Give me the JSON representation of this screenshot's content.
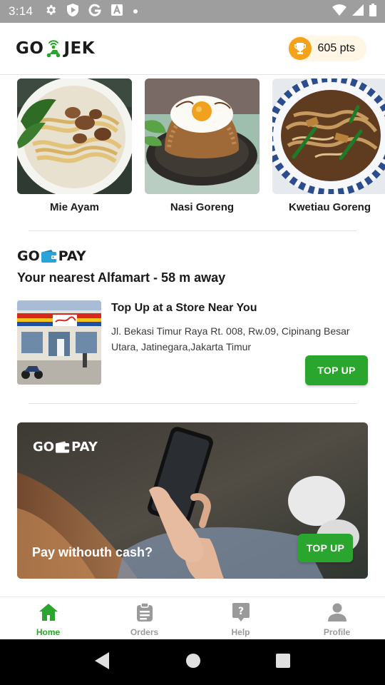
{
  "status_bar": {
    "time": "3:14",
    "left_icons": [
      "gear-icon",
      "shield-icon",
      "google-icon",
      "font-icon",
      "dot-icon"
    ],
    "right_icons": [
      "wifi-icon",
      "signal-icon",
      "battery-icon"
    ]
  },
  "header": {
    "logo_text_left": "GO",
    "logo_text_right": "JEK",
    "points": "605 pts",
    "colors": {
      "accent": "#f3a21a",
      "pill_bg": "#fff6e6"
    }
  },
  "food_items": [
    {
      "name": "Mie Ayam"
    },
    {
      "name": "Nasi Goreng"
    },
    {
      "name": "Kwetiau Goreng"
    }
  ],
  "store_section": {
    "brand_left": "GO",
    "brand_right": "PAY",
    "heading": "Your nearest Alfamart - 58 m away",
    "store_title": "Top Up at a Store Near You",
    "address": "Jl. Bekasi Timur Raya Rt. 008, Rw.09, Cipinang Besar Utara, Jatinegara,Jakarta Timur",
    "button_label": "TOP UP"
  },
  "banner": {
    "brand_left": "GO",
    "brand_right": "PAY",
    "caption": "Pay withouth cash?",
    "button_label": "TOP UP"
  },
  "bottom_nav": {
    "items": [
      {
        "label": "Home",
        "icon": "home-icon",
        "active": true
      },
      {
        "label": "Orders",
        "icon": "clipboard-icon",
        "active": false
      },
      {
        "label": "Help",
        "icon": "help-icon",
        "active": false
      },
      {
        "label": "Profile",
        "icon": "user-icon",
        "active": false
      }
    ]
  },
  "system_nav": [
    "back-icon",
    "home-circle-icon",
    "recents-icon"
  ],
  "colors": {
    "green": "#2aa52e",
    "inactive": "#9a9a9a",
    "text": "#1a1a1a"
  }
}
